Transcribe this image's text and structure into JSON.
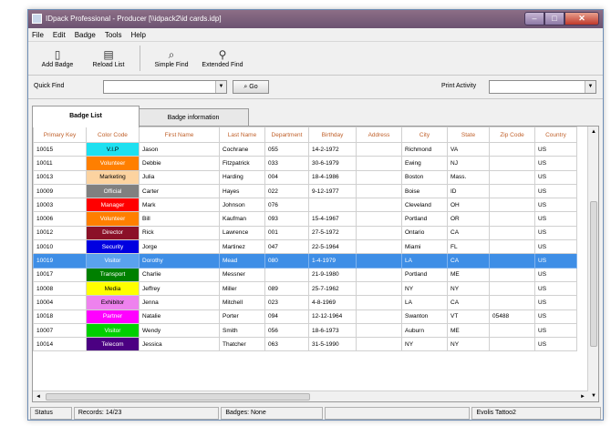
{
  "window": {
    "title": "IDpack Professional - Producer [\\\\idpack2\\id cards.idp]"
  },
  "titlebar_buttons": {
    "minimize": "–",
    "maximize": "□",
    "close": "✕"
  },
  "menu": [
    "File",
    "Edit",
    "Badge",
    "Tools",
    "Help"
  ],
  "toolbar": [
    {
      "label": "Add Badge",
      "icon": "add-badge-icon"
    },
    {
      "label": "Reload List",
      "icon": "reload-list-icon"
    },
    {
      "label": "Simple Find",
      "icon": "simple-find-icon"
    },
    {
      "label": "Extended Find",
      "icon": "extended-find-icon"
    }
  ],
  "quickfind": {
    "label": "Quick Find",
    "value": "",
    "go_label": "Go",
    "print_activity_label": "Print Activity",
    "print_activity_value": ""
  },
  "tabs": [
    {
      "label": "Badge List",
      "active": true
    },
    {
      "label": "Badge information",
      "active": false
    }
  ],
  "grid": {
    "columns": [
      "Primary Key",
      "Color Code",
      "First Name",
      "Last Name",
      "Department",
      "Birthday",
      "Address",
      "City",
      "State",
      "Zip Code",
      "Country"
    ],
    "rows": [
      {
        "key": "10015",
        "code": "V.I.P",
        "color": "#1ee0f0",
        "text_color": "#000000",
        "first": "Jason",
        "last": "Cochrane",
        "dept": "055",
        "bday": "14-2-1972",
        "addr": "",
        "city": "Richmond",
        "state": "VA",
        "zip": "",
        "country": "US"
      },
      {
        "key": "10011",
        "code": "Volunteer",
        "color": "#ff7f00",
        "text_color": "#ffffff",
        "first": "Debbie",
        "last": "Fitzpatrick",
        "dept": "033",
        "bday": "30-6-1979",
        "addr": "",
        "city": "Ewing",
        "state": "NJ",
        "zip": "",
        "country": "US"
      },
      {
        "key": "10013",
        "code": "Marketing",
        "color": "#fcd3a0",
        "text_color": "#000000",
        "first": "Julia",
        "last": "Harding",
        "dept": "004",
        "bday": "18-4-1986",
        "addr": "",
        "city": "Boston",
        "state": "Mass.",
        "zip": "",
        "country": "US"
      },
      {
        "key": "10009",
        "code": "Official",
        "color": "#808080",
        "text_color": "#ffffff",
        "first": "Carter",
        "last": "Hayes",
        "dept": "022",
        "bday": "9-12-1977",
        "addr": "",
        "city": "Boise",
        "state": "ID",
        "zip": "",
        "country": "US"
      },
      {
        "key": "10003",
        "code": "Manager",
        "color": "#ff0000",
        "text_color": "#ffffff",
        "first": "Mark",
        "last": "Johnson",
        "dept": "076",
        "bday": "",
        "addr": "",
        "city": "Cleveland",
        "state": "OH",
        "zip": "",
        "country": "US"
      },
      {
        "key": "10006",
        "code": "Volunteer",
        "color": "#ff7f00",
        "text_color": "#ffffff",
        "first": "Bill",
        "last": "Kaufman",
        "dept": "093",
        "bday": "15-4-1967",
        "addr": "",
        "city": "Portland",
        "state": "OR",
        "zip": "",
        "country": "US"
      },
      {
        "key": "10012",
        "code": "Director",
        "color": "#8b1028",
        "text_color": "#ffffff",
        "first": "Rick",
        "last": "Lawrence",
        "dept": "001",
        "bday": "27-5-1972",
        "addr": "",
        "city": "Ontario",
        "state": "CA",
        "zip": "",
        "country": "US"
      },
      {
        "key": "10010",
        "code": "Security",
        "color": "#0000e0",
        "text_color": "#ffffff",
        "first": "Jorge",
        "last": "Martinez",
        "dept": "047",
        "bday": "22-5-1964",
        "addr": "",
        "city": "Miami",
        "state": "FL",
        "zip": "",
        "country": "US"
      },
      {
        "key": "10019",
        "code": "Visitor",
        "color": "#3e8ee6",
        "text_color": "#ffffff",
        "first": "Dorothy",
        "last": "Mead",
        "dept": "080",
        "bday": "1-4-1979",
        "addr": "",
        "city": "LA",
        "state": "CA",
        "zip": "",
        "country": "US",
        "selected": true
      },
      {
        "key": "10017",
        "code": "Transport",
        "color": "#008000",
        "text_color": "#ffffff",
        "first": "Charlie",
        "last": "Messner",
        "dept": "",
        "bday": "21-9-1980",
        "addr": "",
        "city": "Portland",
        "state": "ME",
        "zip": "",
        "country": "US"
      },
      {
        "key": "10008",
        "code": "Media",
        "color": "#ffff00",
        "text_color": "#000000",
        "first": "Jeffrey",
        "last": "Miller",
        "dept": "089",
        "bday": "25-7-1962",
        "addr": "",
        "city": "NY",
        "state": "NY",
        "zip": "",
        "country": "US"
      },
      {
        "key": "10004",
        "code": "Exhibitor",
        "color": "#ee82ee",
        "text_color": "#000000",
        "first": "Jenna",
        "last": "Mitchell",
        "dept": "023",
        "bday": "4-8-1969",
        "addr": "",
        "city": "LA",
        "state": "CA",
        "zip": "",
        "country": "US"
      },
      {
        "key": "10018",
        "code": "Partner",
        "color": "#ff00ff",
        "text_color": "#ffffff",
        "first": "Natalie",
        "last": "Porter",
        "dept": "094",
        "bday": "12-12-1964",
        "addr": "",
        "city": "Swanton",
        "state": "VT",
        "zip": "05488",
        "country": "US"
      },
      {
        "key": "10007",
        "code": "Visitor",
        "color": "#00d000",
        "text_color": "#ffffff",
        "first": "Wendy",
        "last": "Smith",
        "dept": "056",
        "bday": "18-6-1973",
        "addr": "",
        "city": "Auburn",
        "state": "ME",
        "zip": "",
        "country": "US"
      },
      {
        "key": "10014",
        "code": "Telecom",
        "color": "#4b0082",
        "text_color": "#ffffff",
        "first": "Jessica",
        "last": "Thatcher",
        "dept": "063",
        "bday": "31-5-1990",
        "addr": "",
        "city": "NY",
        "state": "NY",
        "zip": "",
        "country": "US"
      }
    ]
  },
  "status": {
    "label": "Status",
    "records": "Records: 14/23",
    "badges": "Badges: None",
    "extra": "",
    "printer": "Evolis Tattoo2"
  }
}
